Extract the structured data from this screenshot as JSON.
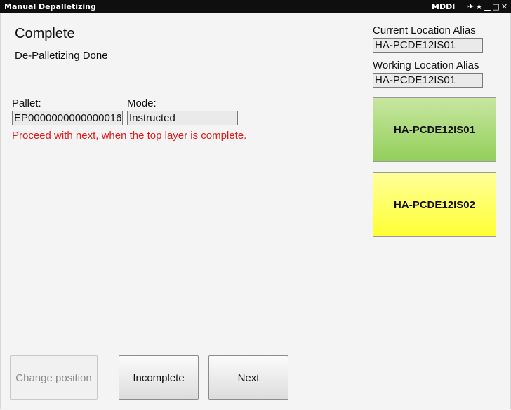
{
  "window": {
    "title": "Manual Depalletizing",
    "brand": "MDDI",
    "controls": {
      "pin": "✈",
      "favorite": "★",
      "minimize": "▁",
      "maximize": "□",
      "close": "✕"
    }
  },
  "status": {
    "heading": "Complete",
    "subheading": "De-Palletizing Done"
  },
  "pallet": {
    "label": "Pallet:",
    "value": "EP0000000000000016"
  },
  "mode": {
    "label": "Mode:",
    "value": "Instructed"
  },
  "message": "Proceed with next, when the top layer is complete.",
  "locations": {
    "current_label": "Current Location Alias",
    "current_value": "HA-PCDE12IS01",
    "working_label": "Working Location Alias",
    "working_value": "HA-PCDE12IS01",
    "buttons": [
      {
        "label": "HA-PCDE12IS01",
        "color": "#92cf5a"
      },
      {
        "label": "HA-PCDE12IS02",
        "color": "#ffff33"
      }
    ]
  },
  "actions": {
    "change_position": "Change position",
    "incomplete": "Incomplete",
    "next": "Next"
  },
  "colors": {
    "warning": "#e21a1a",
    "titlebar": "#0f0f0f"
  }
}
